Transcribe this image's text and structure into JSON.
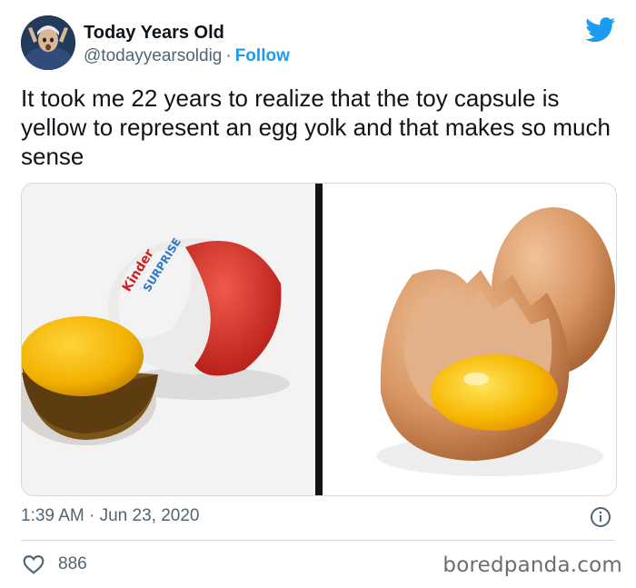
{
  "user": {
    "display_name": "Today Years Old",
    "handle": "@todayyearsoldig",
    "separator": "·",
    "follow_label": "Follow"
  },
  "tweet": {
    "text": "It took me 22 years to realize that the toy capsule is yellow to represent an egg yolk and that makes so much sense",
    "timestamp": "1:39 AM · Jun 23, 2020",
    "like_count": "886"
  },
  "media": {
    "left_image": "kinder-surprise-capsule",
    "right_image": "cracked-egg-with-yolk"
  },
  "icons": {
    "brand": "twitter-bird-icon",
    "info": "info-icon",
    "like": "heart-icon"
  },
  "colors": {
    "accent": "#1d9bf0",
    "text": "#0f1419",
    "muted": "#536471",
    "border": "#cfd9de"
  },
  "watermark": "boredpanda.com"
}
